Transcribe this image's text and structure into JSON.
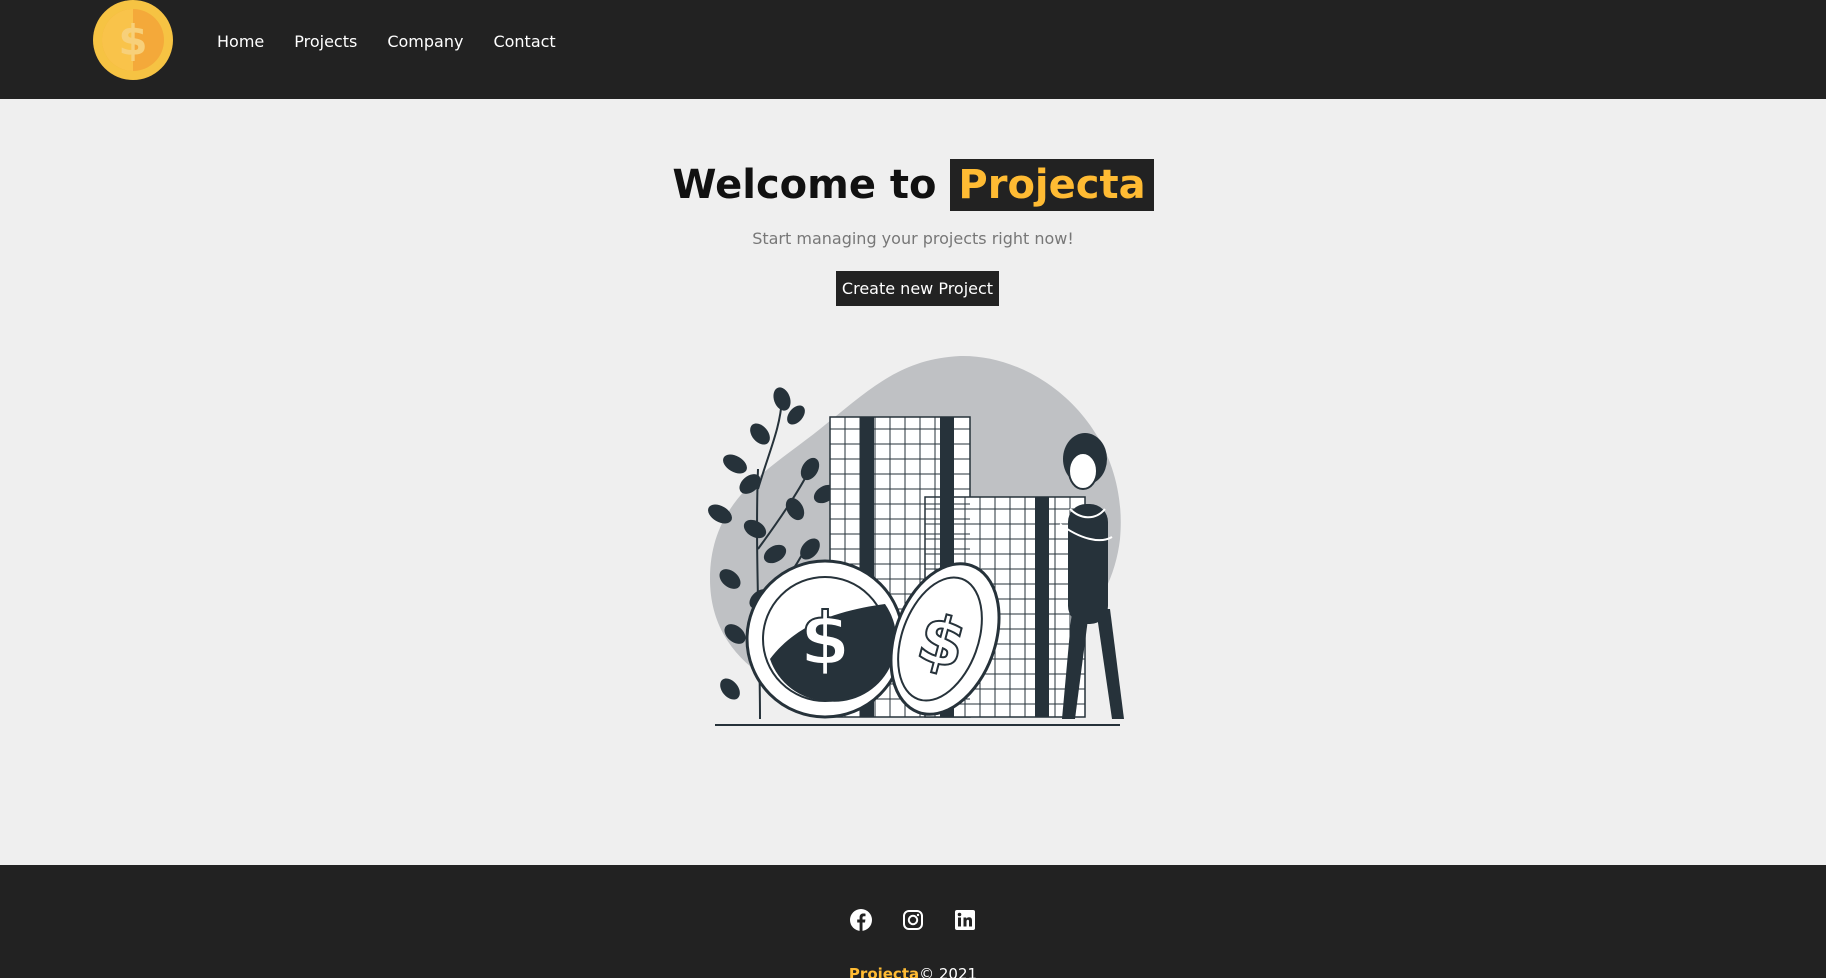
{
  "header": {
    "logo_icon": "gold-dollar-coin-icon",
    "nav": [
      {
        "label": "Home"
      },
      {
        "label": "Projects"
      },
      {
        "label": "Company"
      },
      {
        "label": "Contact"
      }
    ]
  },
  "hero": {
    "title_prefix": "Welcome to",
    "title_brand": "Projecta",
    "subtitle": "Start managing your projects right now!",
    "cta_label": "Create new Project",
    "illustration": "savings-coins-woman-illustration"
  },
  "footer": {
    "social_icons": [
      "facebook-icon",
      "instagram-icon",
      "linkedin-icon"
    ],
    "brand": "Projecta",
    "copyright": "© 2021"
  },
  "colors": {
    "nav_bg": "#222222",
    "page_bg": "#efefef",
    "accent": "#ffbb33",
    "muted_text": "#777777"
  }
}
